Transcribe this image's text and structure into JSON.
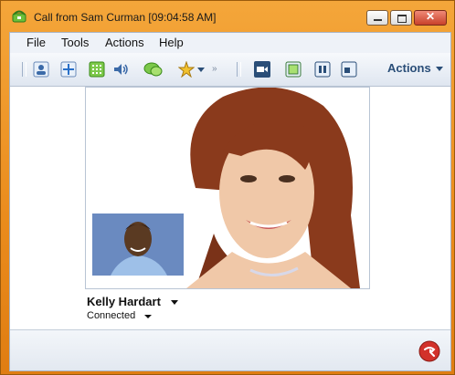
{
  "window": {
    "title": "Call from Sam Curman [09:04:58 AM]",
    "close_glyph": "✕"
  },
  "menu": {
    "items": [
      "File",
      "Tools",
      "Actions",
      "Help"
    ]
  },
  "toolbar": {
    "icons": [
      "user-icon",
      "dialpad-arrows-icon",
      "keypad-icon",
      "speaker-icon",
      "chat-icon",
      "star-icon",
      "overflow-icon",
      "video-camera-icon",
      "share-screen-icon",
      "pause-video-icon",
      "layout-icon"
    ],
    "actions_label": "Actions"
  },
  "contact": {
    "name": "Kelly Hardart",
    "status": "Connected"
  },
  "colors": {
    "window_frame": "#ea8b1c",
    "accent_blue": "#2a4e78",
    "hangup_red": "#d2312a"
  }
}
